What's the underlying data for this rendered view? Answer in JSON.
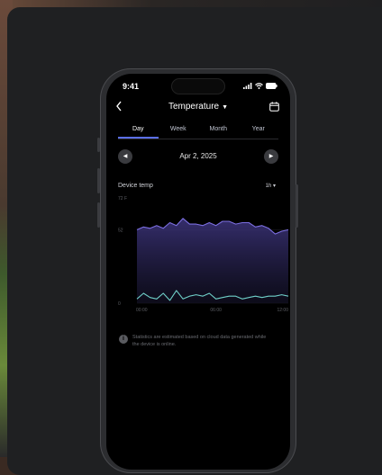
{
  "status": {
    "time": "9:41"
  },
  "header": {
    "title": "Temperature",
    "caret": "▼",
    "back_icon": "chevron-left-icon",
    "calendar_icon": "calendar-icon"
  },
  "tabs": [
    {
      "label": "Day",
      "active": true
    },
    {
      "label": "Week",
      "active": false
    },
    {
      "label": "Month",
      "active": false
    },
    {
      "label": "Year",
      "active": false
    }
  ],
  "date_nav": {
    "label": "Apr 2, 2025",
    "prev": "◀",
    "next": "▶"
  },
  "chart_header": {
    "label": "Device temp",
    "interval": "1h ▾"
  },
  "chart_data": {
    "type": "line",
    "y_unit_label": "72 F",
    "yticks": [
      {
        "value": 52,
        "label": "52"
      },
      {
        "value": 0,
        "label": "0"
      }
    ],
    "ylim": [
      0,
      72
    ],
    "xticks": [
      "00:00",
      "06:00",
      "12:00"
    ],
    "x": [
      0,
      1,
      2,
      3,
      4,
      5,
      6,
      7,
      8,
      9,
      10,
      11,
      12,
      13,
      14,
      15,
      16,
      17,
      18,
      19,
      20,
      21,
      22,
      23
    ],
    "series": [
      {
        "color": "#7b6ee0",
        "values": [
          52,
          54,
          53,
          55,
          53,
          57,
          55,
          60,
          56,
          56,
          55,
          57,
          55,
          58,
          58,
          56,
          57,
          57,
          54,
          55,
          53,
          49,
          51,
          52
        ]
      },
      {
        "color": "#6fd0c9",
        "values": [
          3,
          7,
          4,
          3,
          7,
          2,
          9,
          3,
          5,
          6,
          5,
          7,
          3,
          4,
          5,
          5,
          3,
          4,
          5,
          4,
          5,
          5,
          6,
          5
        ]
      }
    ]
  },
  "note": {
    "text": "Statistics are estimated based on cloud data generated while the device is online.",
    "icon": "info-icon"
  }
}
